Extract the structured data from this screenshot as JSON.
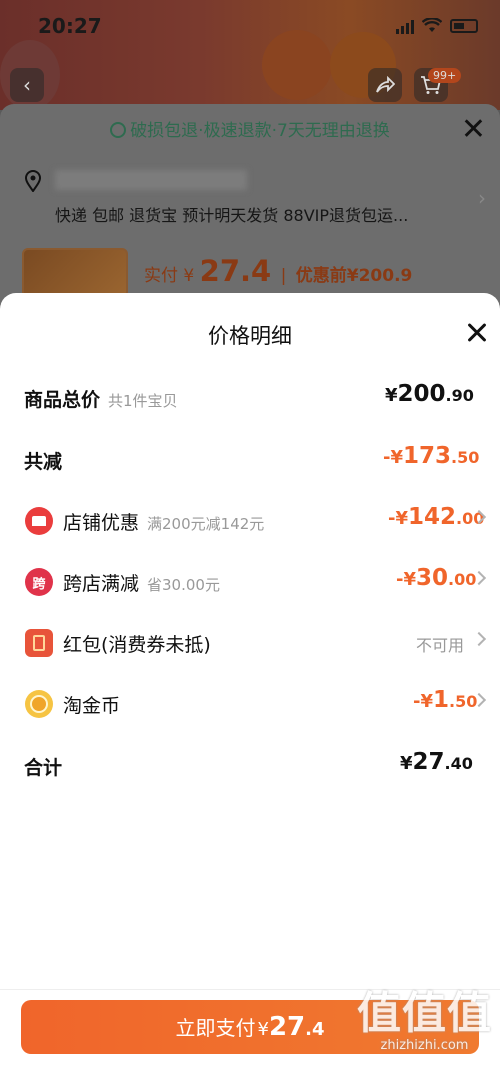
{
  "status": {
    "time": "20:27"
  },
  "header": {
    "cart_badge": "99+"
  },
  "background": {
    "guarantee": "破损包退·极速退款·7天无理由退换",
    "shipping": "快递 包邮 退货宝 预计明天发货 88VIP退货包运...",
    "pay_label": "实付",
    "pay_currency": "¥",
    "pay_amount": "27.4",
    "before_label": "优惠前",
    "before_amount": "¥200.9"
  },
  "sheet": {
    "title": "价格明细",
    "rows": [
      {
        "label": "商品总价",
        "sub": "共1件宝贝",
        "currency": "¥",
        "int": "200",
        "dec": ".90"
      },
      {
        "label": "共减",
        "currency": "-¥",
        "int": "173",
        "dec": ".50"
      },
      {
        "label": "店铺优惠",
        "sub": "满200元减142元",
        "currency": "-¥",
        "int": "142",
        "dec": ".00"
      },
      {
        "label": "跨店满减",
        "sub": "省30.00元",
        "currency": "-¥",
        "int": "30",
        "dec": ".00",
        "icon_text": "跨"
      },
      {
        "label": "红包(消费券未抵)",
        "note": "不可用"
      },
      {
        "label": "淘金币",
        "currency": "-¥",
        "int": "1",
        "dec": ".50"
      },
      {
        "label": "合计",
        "currency": "¥",
        "int": "27",
        "dec": ".40"
      }
    ],
    "pay_button": {
      "label": "立即支付",
      "currency": "¥",
      "int": "27",
      "dec": ".4"
    }
  },
  "watermark": {
    "glyphs": [
      "值",
      "值",
      "值"
    ],
    "site": "zhizhizhi.com"
  },
  "colors": {
    "accent": "#f0652b",
    "shop_icon": "#ea3d3d",
    "green": "#2e6b4f"
  }
}
